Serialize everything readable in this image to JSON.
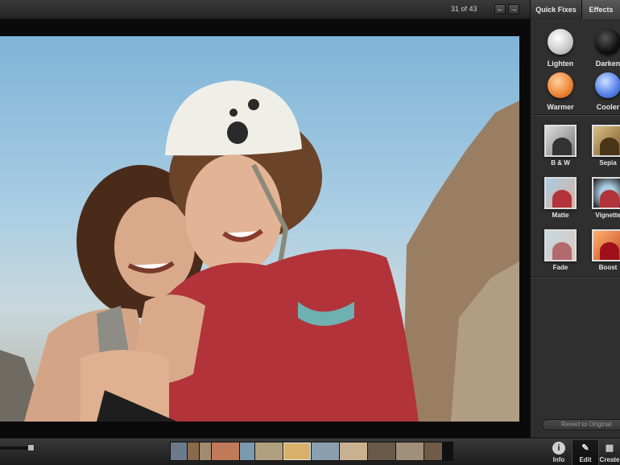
{
  "topbar": {
    "photo_counter": "31 of 43",
    "prev_glyph": "←",
    "next_glyph": "→",
    "tabs": [
      {
        "label": "Quick Fixes"
      },
      {
        "label": "Effects"
      }
    ]
  },
  "effects_panel": {
    "color_effects": [
      {
        "label": "Lighten",
        "color": "#e8e8e8"
      },
      {
        "label": "Darken",
        "color": "#111111"
      },
      {
        "label": "Warmer",
        "color": "#f08a3a"
      },
      {
        "label": "Cooler",
        "color": "#5a86e8"
      }
    ],
    "filter_effects": [
      {
        "label": "B & W"
      },
      {
        "label": "Sepia"
      },
      {
        "label": "Matte"
      },
      {
        "label": "Vignette"
      },
      {
        "label": "Fade"
      },
      {
        "label": "Boost"
      }
    ],
    "revert_label": "Revert to Original"
  },
  "toolbar": {
    "info_label": "Info",
    "edit_label": "Edit",
    "create_label": "Create"
  }
}
